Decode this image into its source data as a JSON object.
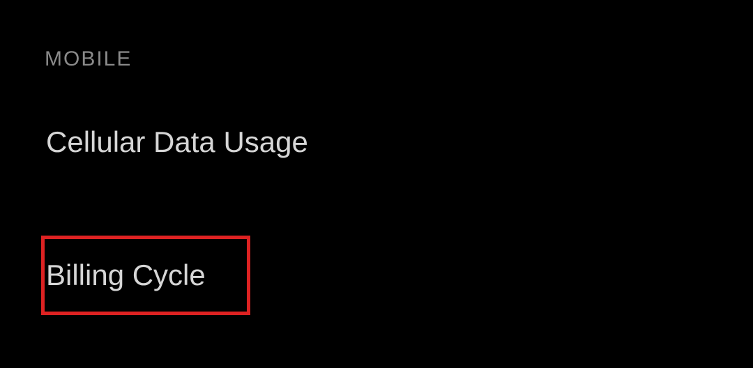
{
  "section": {
    "header": "MOBILE"
  },
  "items": {
    "cellular": "Cellular Data Usage",
    "billing": "Billing Cycle"
  }
}
